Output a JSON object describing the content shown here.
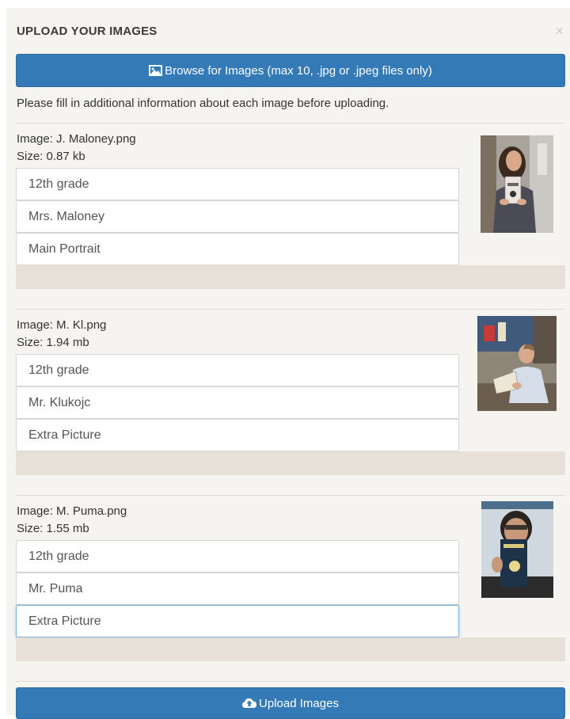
{
  "modal": {
    "title": "UPLOAD YOUR IMAGES",
    "close_glyph": "×",
    "browse_label": "Browse for Images (max 10, .jpg or .jpeg files only)",
    "instructions": "Please fill in additional information about each image before uploading.",
    "upload_label": "Upload Images"
  },
  "images": [
    {
      "name": "Image: J. Maloney.png",
      "size": "Size: 0.87 kb",
      "fields": [
        "12th grade",
        "Mrs. Maloney",
        "Main Portrait"
      ],
      "progress": 0
    },
    {
      "name": "Image: M. Kl.png",
      "size": "Size: 1.94 mb",
      "fields": [
        "12th grade",
        "Mr. Klukojc",
        "Extra Picture"
      ],
      "progress": 0
    },
    {
      "name": "Image: M. Puma.png",
      "size": "Size: 1.55 mb",
      "fields": [
        "12th grade",
        "Mr. Puma",
        "Extra Picture"
      ],
      "progress": 0
    }
  ],
  "colors": {
    "primary": "#337ab7",
    "progress_track": "#e6e0d8",
    "modal_bg": "#f6f4f1"
  },
  "icons": {
    "browse": "image-icon",
    "upload": "cloud-upload-icon",
    "close": "close-icon"
  }
}
